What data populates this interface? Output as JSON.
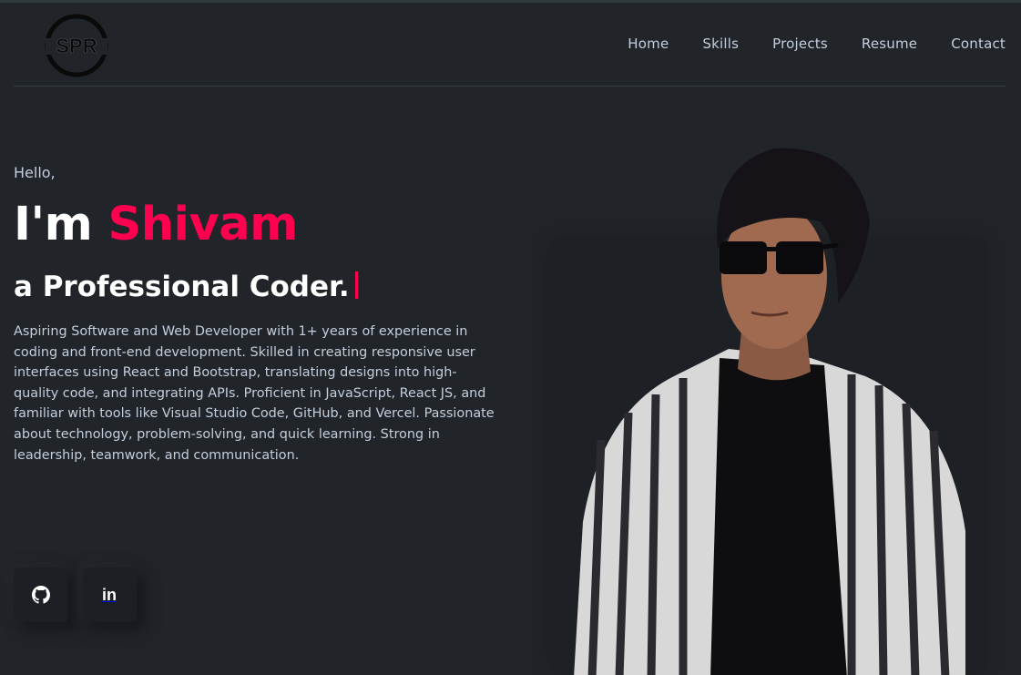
{
  "header": {
    "logo_text": "SPR",
    "nav": [
      "Home",
      "Skills",
      "Projects",
      "Resume",
      "Contact"
    ]
  },
  "hero": {
    "greeting": "Hello,",
    "title_prefix": "I'm",
    "name": "Shivam",
    "subtitle": "a Professional Coder.",
    "description": "Aspiring Software and Web Developer with 1+ years of experience in coding and front-end development. Skilled in creating responsive user interfaces using React and Bootstrap, translating designs into high-quality code, and integrating APIs. Proficient in JavaScript, React JS, and familiar with tools like Visual Studio Code, GitHub, and Vercel. Passionate about technology, problem-solving, and quick learning. Strong in leadership, teamwork, and communication."
  },
  "social": {
    "github_icon": "github-icon",
    "linkedin_label": "in"
  },
  "colors": {
    "background": "#212428",
    "accent": "#ff014f",
    "text": "#c4cfde",
    "heading": "#ffffff"
  }
}
